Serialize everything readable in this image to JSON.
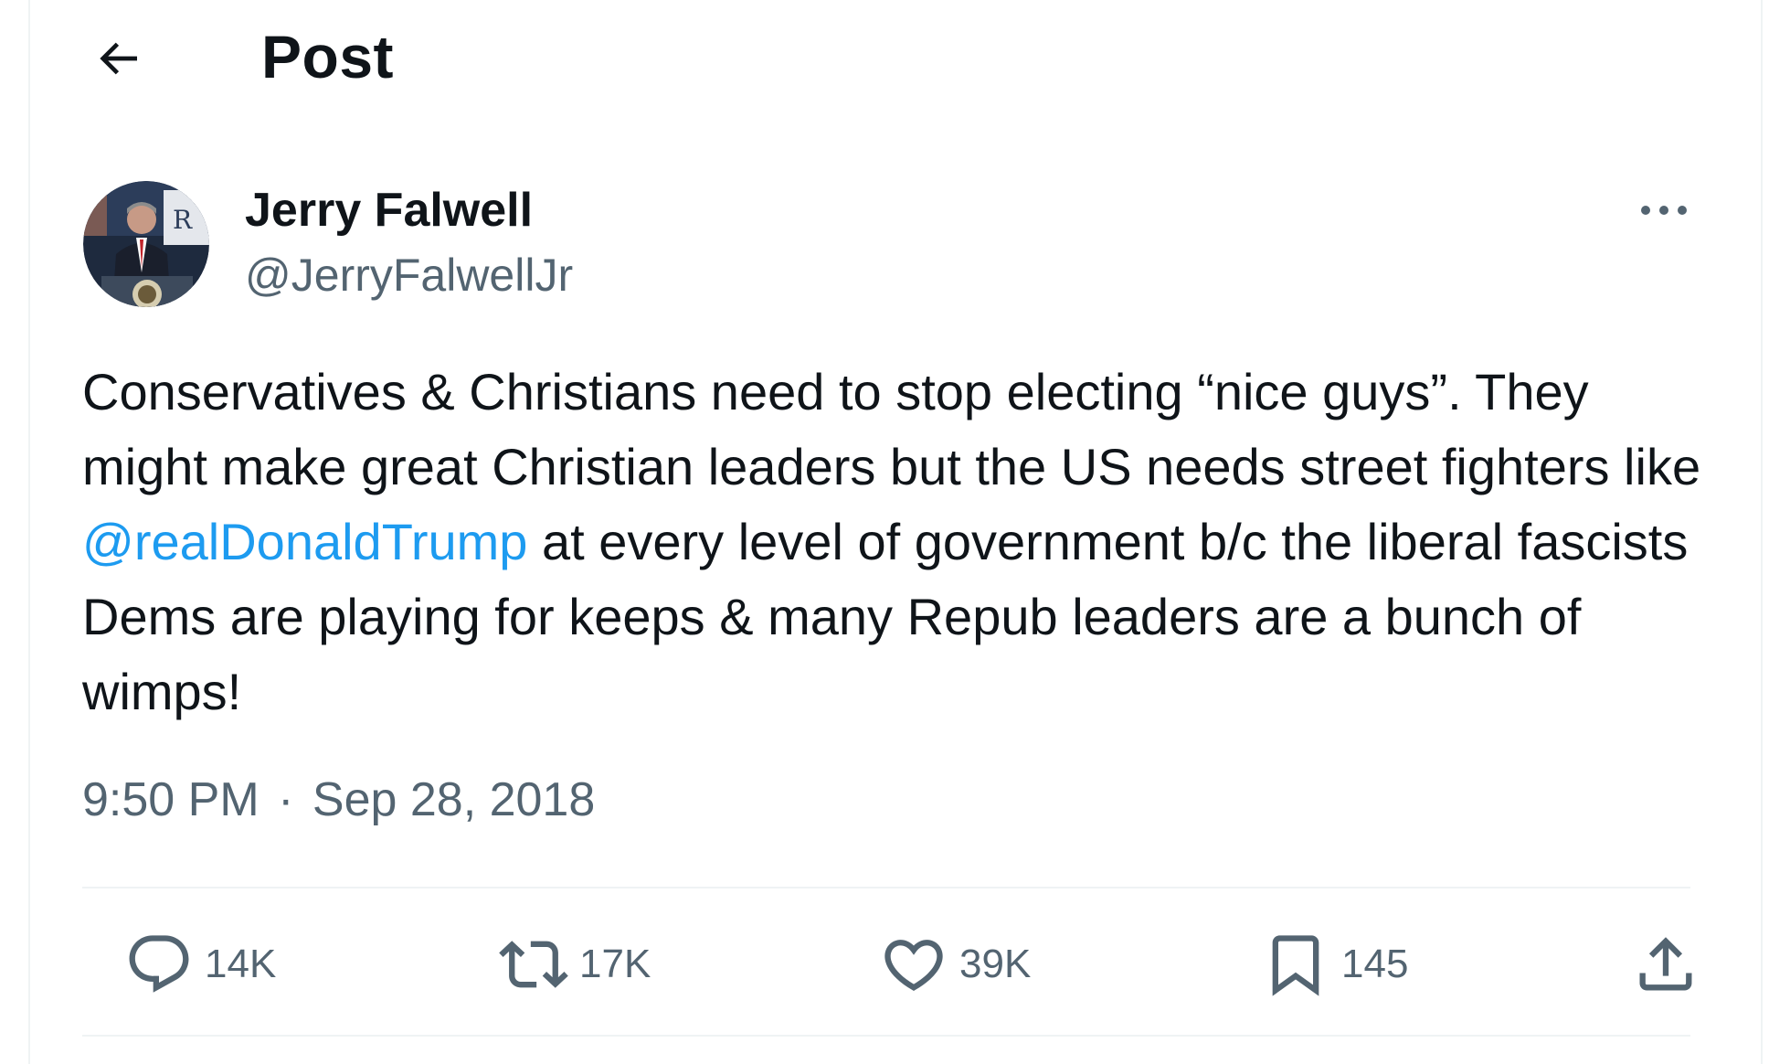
{
  "header": {
    "title": "Post",
    "back_icon": "arrow-left-icon"
  },
  "author": {
    "name": "Jerry Falwell",
    "handle": "@JerryFalwellJr",
    "avatar_icon": "avatar-photo"
  },
  "post": {
    "text_before": "Conservatives & Christians need to stop electing “nice guys”. They might make great Christian leaders but the US needs street fighters like ",
    "mention": "@realDonaldTrump",
    "text_after": " at every level of government b/c the liberal fascists Dems are playing for keeps & many Repub leaders are a bunch of wimps!",
    "time": "9:50 PM",
    "separator": "·",
    "date": "Sep 28, 2018"
  },
  "actions": {
    "replies": "14K",
    "reposts": "17K",
    "likes": "39K",
    "bookmarks": "145"
  },
  "colors": {
    "text": "#0f1419",
    "secondary": "#536471",
    "link": "#1d9bf0",
    "divider": "#eff3f4"
  }
}
